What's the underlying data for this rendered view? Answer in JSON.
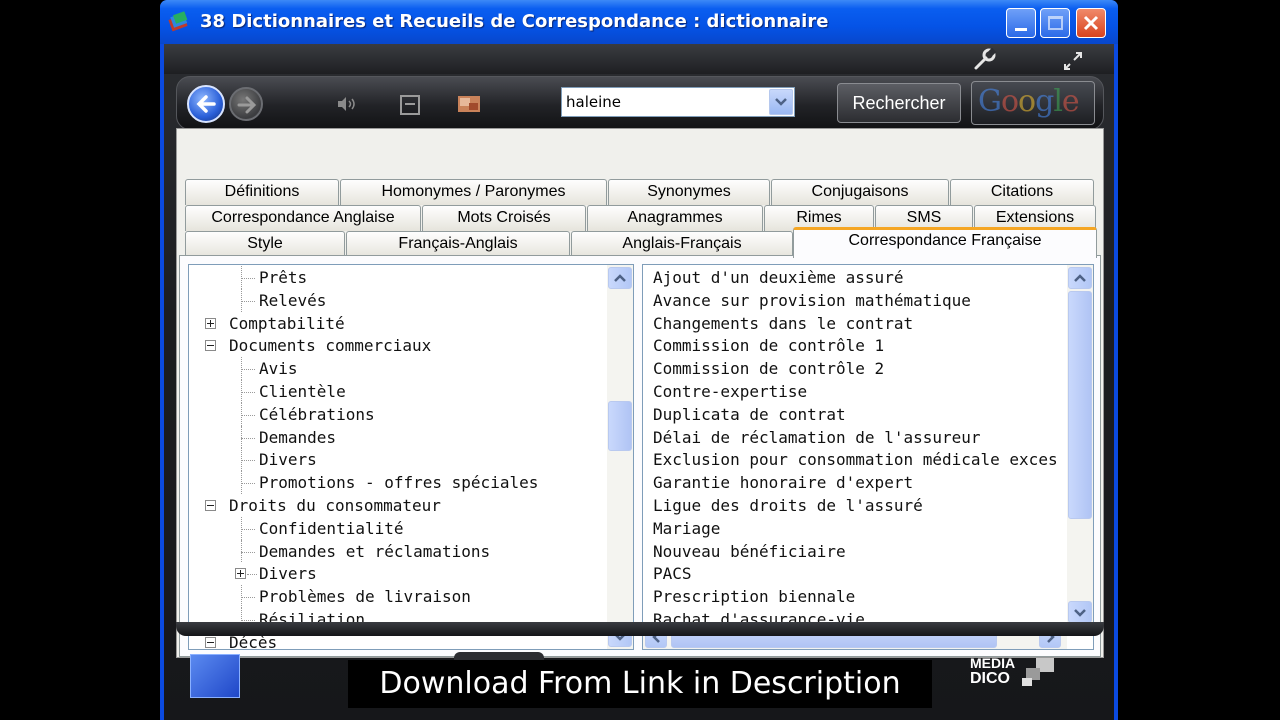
{
  "window": {
    "title": "38 Dictionnaires et Recueils de Correspondance : dictionnaire"
  },
  "toolbar": {
    "search_value": "haleine",
    "search_button": "Rechercher",
    "google_label": "Google"
  },
  "tabs": {
    "row1": [
      "Définitions",
      "Homonymes / Paronymes",
      "Synonymes",
      "Conjugaisons",
      "Citations"
    ],
    "row2": [
      "Correspondance Anglaise",
      "Mots Croisés",
      "Anagrammes",
      "Rimes",
      "SMS",
      "Extensions"
    ],
    "row3": [
      "Style",
      "Français-Anglais",
      "Anglais-Français",
      "Correspondance Française"
    ],
    "active": "Correspondance Française"
  },
  "tree": {
    "items": [
      {
        "label": "Prêts",
        "level": 1
      },
      {
        "label": "Relevés",
        "level": 1
      },
      {
        "label": "Comptabilité",
        "level": 0,
        "state": "collapsed"
      },
      {
        "label": "Documents commerciaux",
        "level": 0,
        "state": "expanded"
      },
      {
        "label": "Avis",
        "level": 1
      },
      {
        "label": "Clientèle",
        "level": 1
      },
      {
        "label": "Célébrations",
        "level": 1
      },
      {
        "label": "Demandes",
        "level": 1
      },
      {
        "label": "Divers",
        "level": 1
      },
      {
        "label": "Promotions - offres spéciales",
        "level": 1
      },
      {
        "label": "Droits du consommateur",
        "level": 0,
        "state": "expanded"
      },
      {
        "label": "Confidentialité",
        "level": 1
      },
      {
        "label": "Demandes et réclamations",
        "level": 1
      },
      {
        "label": "Divers",
        "level": 1,
        "state": "collapsed"
      },
      {
        "label": "Problèmes de livraison",
        "level": 1
      },
      {
        "label": "Résiliation",
        "level": 1
      },
      {
        "label": "Décès",
        "level": 0,
        "state": "expanded"
      }
    ]
  },
  "letters": {
    "items": [
      "Ajout d'un deuxième assuré",
      "Avance sur provision mathématique",
      "Changements dans le contrat",
      "Commission de contrôle 1",
      "Commission de contrôle 2",
      "Contre-expertise",
      "Duplicata de contrat",
      "Délai de réclamation de l'assureur",
      "Exclusion pour consommation médicale exces",
      "Garantie honoraire d'expert",
      "Ligue des droits de l'assuré",
      "Mariage",
      "Nouveau bénéficiaire",
      "PACS",
      "Prescription biennale",
      "Rachat d'assurance-vie"
    ]
  },
  "footer": {
    "brand_line1": "MEDIA",
    "brand_line2": "DICO"
  },
  "caption": "Download From Link in Description"
}
